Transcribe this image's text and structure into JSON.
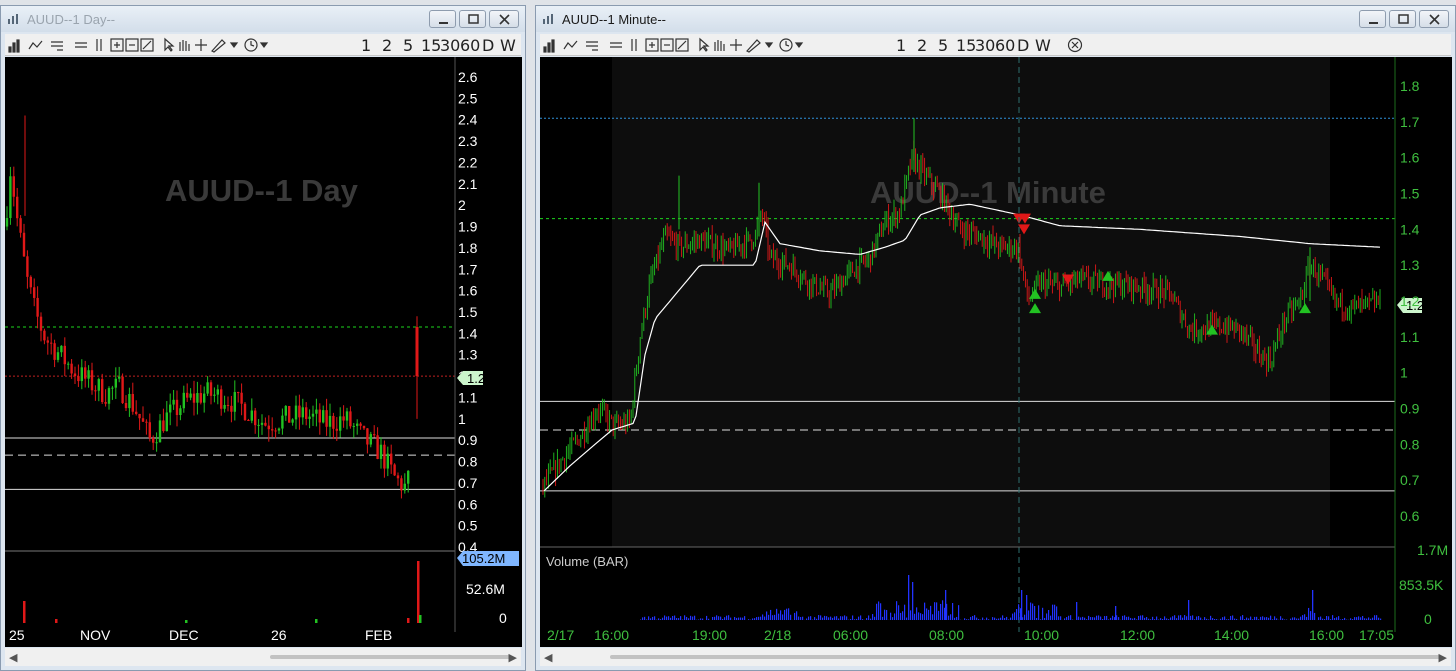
{
  "left_window": {
    "title": "AUUD--1 Day--",
    "watermark": "AUUD--1 Day",
    "toolbar_timeframes": [
      "1",
      "2",
      "5",
      "15",
      "30",
      "60",
      "D",
      "W"
    ],
    "price_badge": "1.2",
    "volume_badge": "105.2M",
    "y_ticks": [
      "2.6",
      "2.5",
      "2.4",
      "2.3",
      "2.2",
      "2.1",
      "2",
      "1.9",
      "1.8",
      "1.7",
      "1.6",
      "1.5",
      "1.4",
      "1.3",
      "1.2",
      "1.1",
      "1",
      "0.9",
      "0.8",
      "0.7",
      "0.6",
      "0.5",
      "0.4"
    ],
    "volume_ticks": [
      "52.6M",
      "0"
    ],
    "x_ticks": [
      "25",
      "NOV",
      "DEC",
      "26",
      "FEB"
    ]
  },
  "right_window": {
    "title": "AUUD--1 Minute--",
    "watermark": "AUUD--1 Minute",
    "toolbar_timeframes": [
      "1",
      "2",
      "5",
      "15",
      "30",
      "60",
      "D",
      "W"
    ],
    "price_badge": "1.2",
    "volume_title": "Volume (BAR)",
    "y_ticks": [
      "1.8",
      "1.7",
      "1.6",
      "1.5",
      "1.4",
      "1.3",
      "1.2",
      "1.1",
      "1",
      "0.9",
      "0.8",
      "0.7",
      "0.6"
    ],
    "volume_ticks": [
      "1.7M",
      "853.5K",
      "0"
    ],
    "x_ticks": [
      "2/17",
      "16:00",
      "19:00",
      "2/18",
      "06:00",
      "08:00",
      "10:00",
      "12:00",
      "14:00",
      "16:00",
      "17:05"
    ]
  },
  "colors": {
    "up": "#22c222",
    "down": "#e01818",
    "vwap": "#ffffff",
    "level_green": "#1dd31d",
    "level_blue": "#2f8fd8",
    "volume": "#2233ff"
  },
  "chart_data": [
    {
      "type": "candlestick",
      "symbol": "AUUD",
      "interval": "1 Day",
      "ylim": [
        0.4,
        2.6
      ],
      "price_lines": [
        1.43,
        1.2,
        0.91,
        0.83,
        0.67
      ],
      "last_price": 1.2
    },
    {
      "type": "candlestick",
      "symbol": "AUUD",
      "interval": "1 Minute",
      "ylim": [
        0.6,
        1.8
      ],
      "price_lines": [
        1.71,
        1.43,
        0.92,
        0.84,
        0.67
      ],
      "last_price": 1.2,
      "volume_max": "1.7M"
    }
  ]
}
